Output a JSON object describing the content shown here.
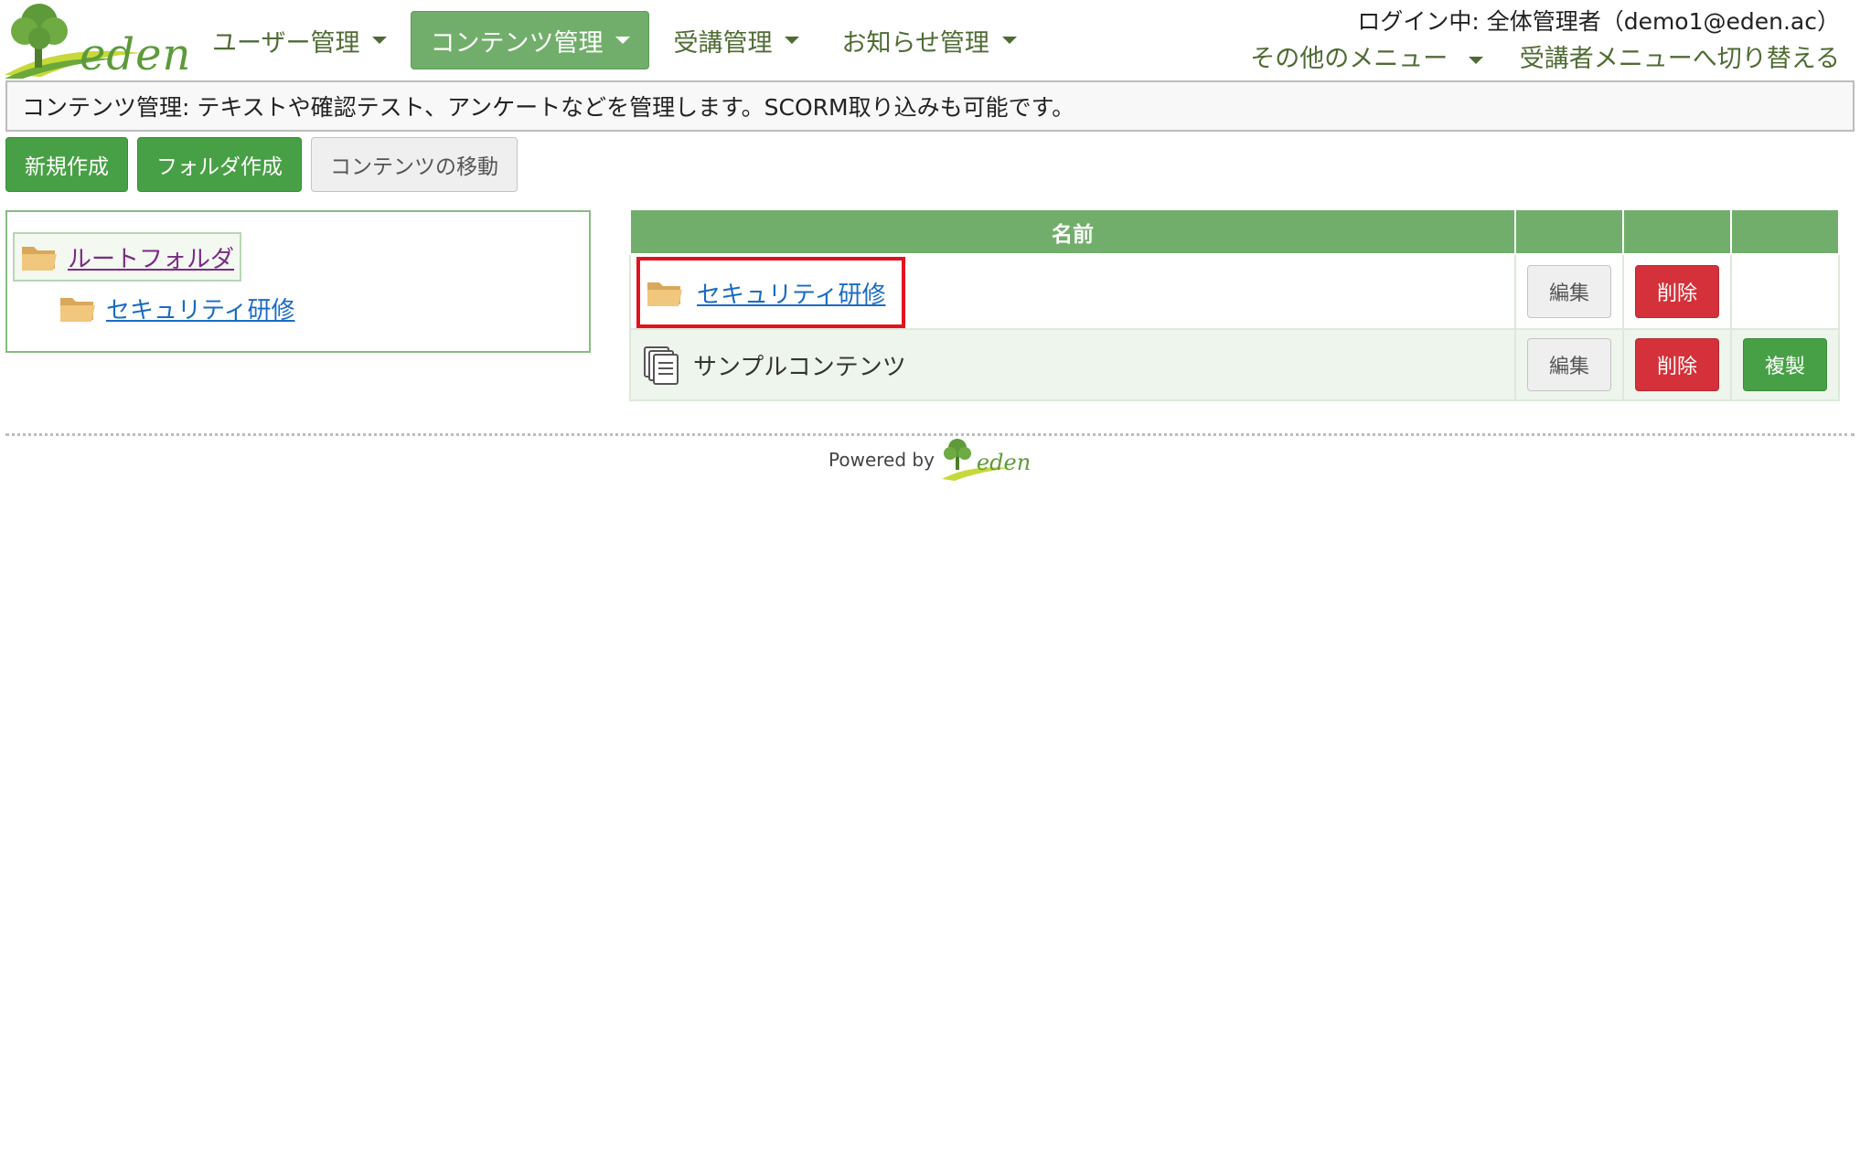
{
  "header": {
    "logo_text": "eden",
    "nav": [
      {
        "label": "ユーザー管理",
        "active": false
      },
      {
        "label": "コンテンツ管理",
        "active": true
      },
      {
        "label": "受講管理",
        "active": false
      },
      {
        "label": "お知らせ管理",
        "active": false
      }
    ],
    "login_info": "ログイン中: 全体管理者（demo1@eden.ac）",
    "other_menu_label": "その他のメニュー",
    "switch_label": "受講者メニューへ切り替える"
  },
  "description": "コンテンツ管理: テキストや確認テスト、アンケートなどを管理します。SCORM取り込みも可能です。",
  "actions": {
    "new_label": "新規作成",
    "folder_label": "フォルダ作成",
    "move_label": "コンテンツの移動"
  },
  "tree": {
    "root_label": "ルートフォルダ",
    "child_label": "セキュリティ研修"
  },
  "table": {
    "name_header": "名前",
    "rows": [
      {
        "type": "folder",
        "name": "セキュリティ研修",
        "edit": "編集",
        "delete": "削除",
        "copy": ""
      },
      {
        "type": "content",
        "name": "サンプルコンテンツ",
        "edit": "編集",
        "delete": "削除",
        "copy": "複製"
      }
    ]
  },
  "footer": {
    "powered_by": "Powered by",
    "logo_text": "eden"
  },
  "colors": {
    "brand_green": "#72ae6b",
    "button_green": "#48a046",
    "button_red": "#d4313a",
    "highlight_red": "#e0141e",
    "link_blue": "#1a6bc4",
    "link_visited": "#7b2b86"
  }
}
